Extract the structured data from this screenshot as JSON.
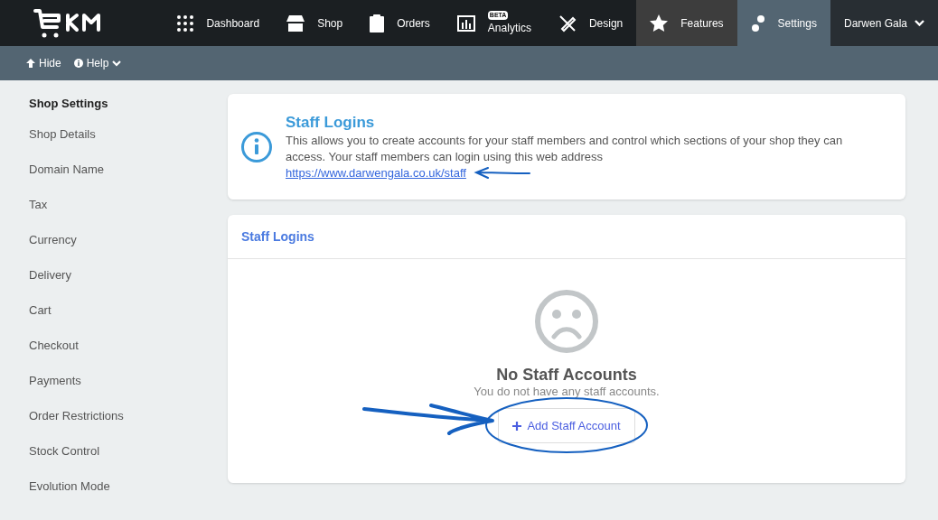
{
  "nav": {
    "items": [
      {
        "label": "Dashboard",
        "selected": false,
        "hovered": false
      },
      {
        "label": "Shop",
        "selected": false,
        "hovered": false
      },
      {
        "label": "Orders",
        "selected": false,
        "hovered": false
      },
      {
        "label": "Analytics",
        "badge": "BETA",
        "selected": false,
        "hovered": false
      },
      {
        "label": "Design",
        "selected": false,
        "hovered": false
      },
      {
        "label": "Features",
        "selected": false,
        "hovered": true
      },
      {
        "label": "Settings",
        "selected": true,
        "hovered": false
      }
    ],
    "user": "Darwen Gala"
  },
  "subbar": {
    "hide": "Hide",
    "help": "Help"
  },
  "sidebar": {
    "heading": "Shop Settings",
    "items": [
      "Shop Details",
      "Domain Name",
      "Tax",
      "Currency",
      "Delivery",
      "Cart",
      "Checkout",
      "Payments",
      "Order Restrictions",
      "Stock Control",
      "Evolution Mode"
    ]
  },
  "info": {
    "title": "Staff Logins",
    "text": "This allows you to create accounts for your staff members and control which sections of your shop they can access. Your staff members can login using this web address",
    "link": "https://www.darwengala.co.uk/staff"
  },
  "panel": {
    "title": "Staff Logins",
    "empty_title": "No Staff Accounts",
    "empty_text": "You do not have any staff accounts.",
    "button": "Add Staff Account"
  }
}
